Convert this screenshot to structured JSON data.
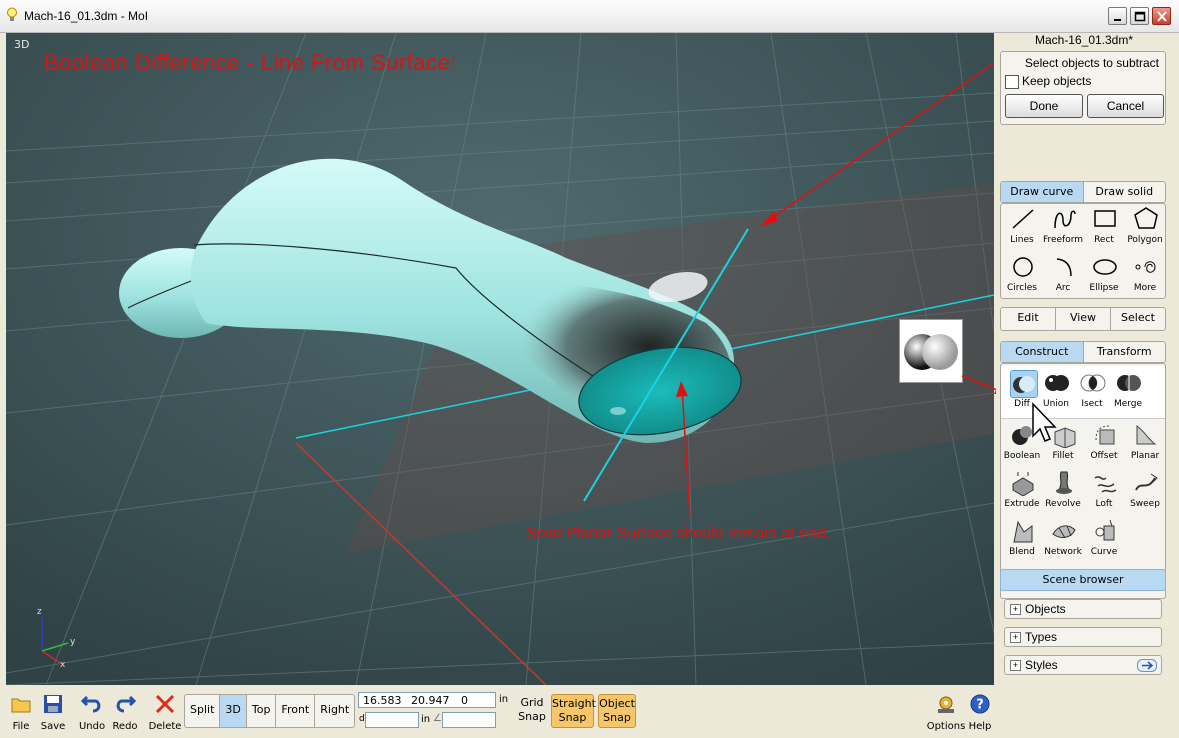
{
  "window": {
    "title": "Mach-16_01.3dm - MoI"
  },
  "viewport": {
    "label": "3D",
    "title": "Boolean Difference - Line From Surface:",
    "note": "Solid Planar Surface should remain at end.",
    "axis": {
      "z": "z",
      "y": "y",
      "x": "x"
    }
  },
  "panel": {
    "filename": "Mach-16_01.3dm*",
    "prompt": {
      "text": "Select objects to subtract",
      "checkbox_label": "Keep objects",
      "done_label": "Done",
      "cancel_label": "Cancel"
    },
    "draw_tabs": [
      "Draw curve",
      "Draw solid"
    ],
    "draw_tools": [
      "Lines",
      "Freeform",
      "Rect",
      "Polygon",
      "Circles",
      "Arc",
      "Ellipse",
      "More"
    ],
    "edit_tabs": [
      "Edit",
      "View",
      "Select"
    ],
    "construct_tabs": [
      "Construct",
      "Transform"
    ],
    "boolean_tools": [
      "Diff",
      "Union",
      "Isect",
      "Merge"
    ],
    "construct_tools": [
      "Boolean",
      "Fillet",
      "Offset",
      "Planar",
      "Extrude",
      "Revolve",
      "Loft",
      "Sweep",
      "Blend",
      "Network",
      "Curve"
    ],
    "scene_browser": "Scene browser",
    "scene_items": [
      "Objects",
      "Types",
      "Styles"
    ]
  },
  "toolbar": {
    "file": "File",
    "save": "Save",
    "undo": "Undo",
    "redo": "Redo",
    "delete": "Delete",
    "views": [
      "Split",
      "3D",
      "Top",
      "Front",
      "Right"
    ],
    "coord_x": "16.583",
    "coord_y": "20.947",
    "coord_z": "0",
    "unit": "in",
    "dist_prefix": "d",
    "dist_unit": "in",
    "angle_symbol": "∠",
    "grid_snap": "Grid Snap",
    "straight_snap": "Straight Snap",
    "object_snap": "Object Snap",
    "options": "Options",
    "help": "Help"
  },
  "colors": {
    "accent": "#b9d9f3",
    "snap": "#f6c66a",
    "annotation": "#e01010",
    "cyan_line": "#19d4e0"
  }
}
